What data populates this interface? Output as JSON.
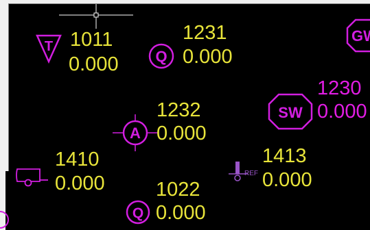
{
  "colors": {
    "background": "#000000",
    "point_label": "#e8e43a",
    "magenta_label": "#e21de4",
    "symbol_magenta": "#d21ee0",
    "ref_symbol": "#9a55c8",
    "crosshair": "#ffffff",
    "ui_chrome": "#f0f0f0"
  },
  "symbols": {
    "t_symbol": {
      "icon": "inverted-triangle-icon",
      "glyph": "T"
    },
    "q_symbol_top": {
      "icon": "circle-marker-icon",
      "glyph": "Q"
    },
    "a_symbol": {
      "icon": "circle-crosshair-marker-icon",
      "glyph": "A"
    },
    "sw_symbol": {
      "icon": "octagon-marker-icon",
      "glyph": "SW"
    },
    "gw_symbol": {
      "icon": "octagon-marker-icon",
      "glyph": "GW"
    },
    "q_symbol_bottom": {
      "icon": "circle-marker-icon",
      "glyph": "Q"
    },
    "vehicle_symbol": {
      "icon": "trailer-icon"
    },
    "ref_symbol": {
      "icon": "reference-marker-icon",
      "tag": "REF"
    }
  },
  "points": {
    "p1011": {
      "number": "1011",
      "elevation": "0.000"
    },
    "p1231": {
      "number": "1231",
      "elevation": "0.000"
    },
    "p1232": {
      "number": "1232",
      "elevation": "0.000"
    },
    "p1230": {
      "number": "1230",
      "elevation": "0.000"
    },
    "p1410": {
      "number": "1410",
      "elevation": "0.000"
    },
    "p1413": {
      "number": "1413",
      "elevation": "0.000"
    },
    "p1022": {
      "number": "1022",
      "elevation": "0.000"
    }
  }
}
